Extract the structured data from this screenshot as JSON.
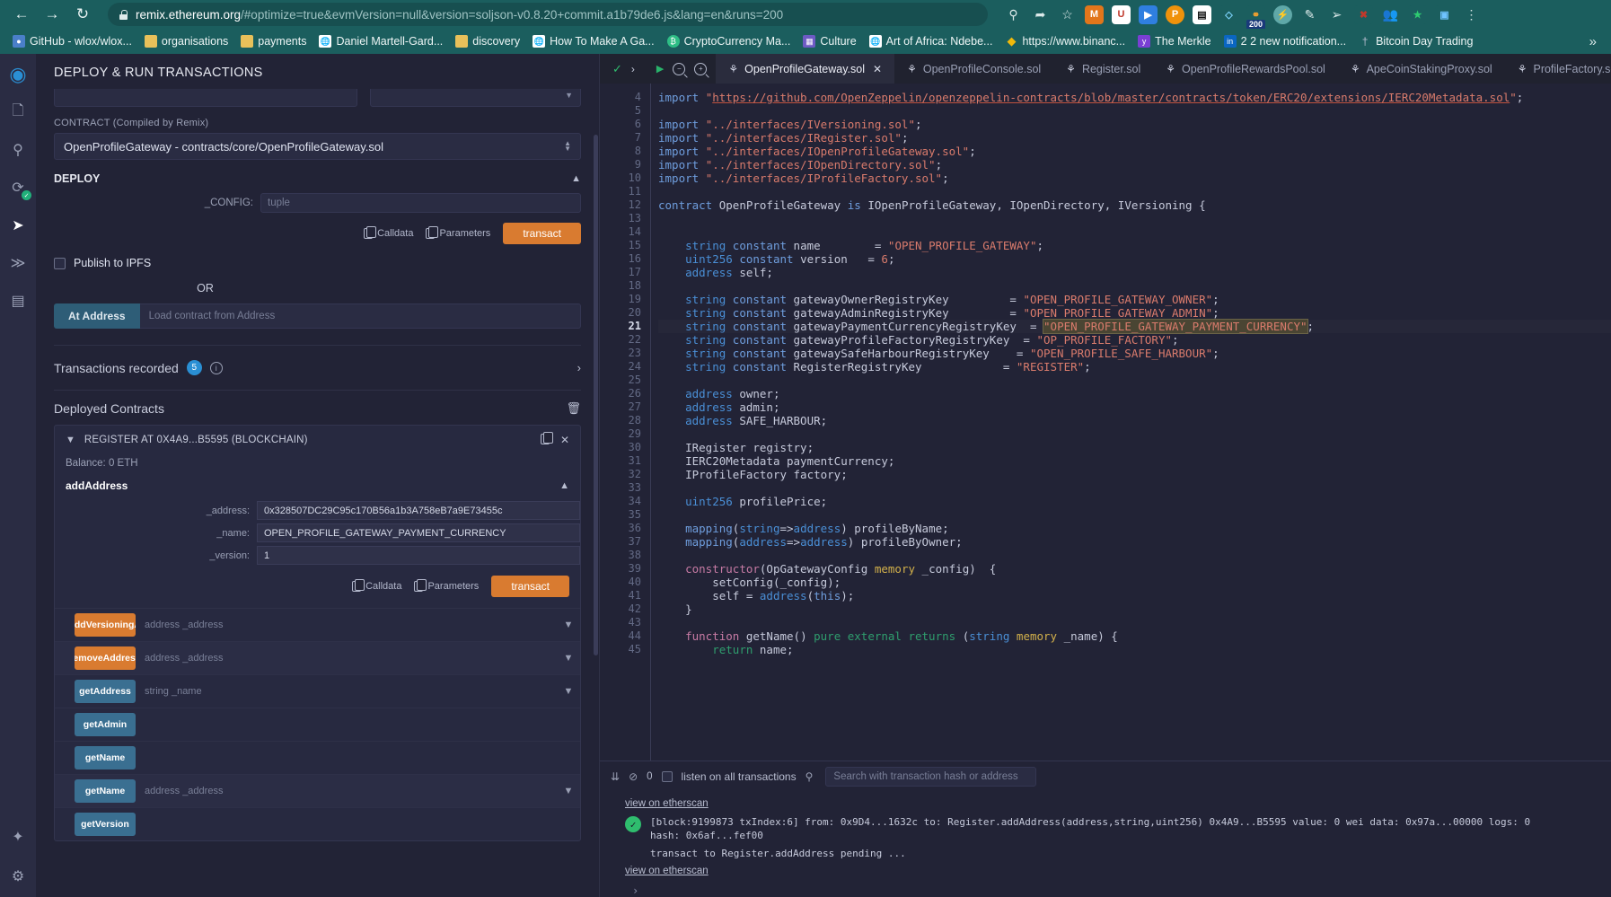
{
  "browser": {
    "url_prefix": "remix.ethereum.org",
    "url_suffix": "/#optimize=true&evmVersion=null&version=soljson-v0.8.20+commit.a1b79de6.js&lang=en&runs=200",
    "nav": {
      "back": "←",
      "forward": "→",
      "reload": "↻"
    },
    "toolbar_icons": [
      "search-icon",
      "share-icon",
      "bookmark-star-icon",
      "metamask-extension",
      "opera-wallet-extension",
      "kite-extension",
      "phantom-extension",
      "qr-extension",
      "brave-wallet-extension",
      "feed-extension",
      "flash-extension",
      "pen-extension",
      "puzzle-extension",
      "cast-extension",
      "profile-avatar",
      "menu-icon"
    ],
    "bookmarks": [
      {
        "label": "GitHub - wlox/wlox...",
        "color": "#4a7fc9"
      },
      {
        "label": "organisations",
        "color": "#e8c05a"
      },
      {
        "label": "payments",
        "color": "#e8c05a"
      },
      {
        "label": "Daniel Martell-Gard...",
        "color": "#ffffff"
      },
      {
        "label": "discovery",
        "color": "#e8c05a"
      },
      {
        "label": "How To Make A Ga...",
        "color": "#ffffff"
      },
      {
        "label": "CryptoCurrency Ma...",
        "color": "#2ebd85"
      },
      {
        "label": "Culture",
        "color": "#6d5ac4"
      },
      {
        "label": "Art of Africa: Ndebe...",
        "color": "#ffffff"
      },
      {
        "label": "https://www.binanc...",
        "color": "#f0b90b"
      },
      {
        "label": "The Merkle",
        "color": "#7a3fd4"
      },
      {
        "label": "2 2 new notification...",
        "color": "#0a66c2"
      },
      {
        "label": "Bitcoin Day Trading",
        "color": "#b9bed1"
      }
    ],
    "bookmarks_overflow": "»"
  },
  "rail": {
    "items": [
      {
        "name": "remix-home-icon"
      },
      {
        "name": "file-explorer-icon"
      },
      {
        "name": "search-icon"
      },
      {
        "name": "solidity-compiler-icon",
        "badge": "✓"
      },
      {
        "name": "deploy-run-icon",
        "active": true
      },
      {
        "name": "debugger-icon"
      },
      {
        "name": "plugin-manager-icon"
      }
    ],
    "bottom": [
      {
        "name": "plugin-settings-icon"
      },
      {
        "name": "settings-gear-icon"
      }
    ]
  },
  "udapp": {
    "title": "DEPLOY & RUN TRANSACTIONS",
    "account_value": "",
    "gas_value": "",
    "contract_label": "CONTRACT (Compiled by Remix)",
    "contract_value": "OpenProfileGateway - contracts/core/OpenProfileGateway.sol",
    "deploy_label": "DEPLOY",
    "deploy_param_label": "_CONFIG:",
    "deploy_param_placeholder": "tuple",
    "calldata_label": "Calldata",
    "parameters_label": "Parameters",
    "transact_label": "transact",
    "publish_ipfs_label": "Publish to IPFS",
    "or_label": "OR",
    "at_address_label": "At Address",
    "at_address_placeholder": "Load contract from Address",
    "transactions_recorded_label": "Transactions recorded",
    "transactions_recorded_count": "5",
    "deployed_contracts_label": "Deployed Contracts",
    "contract_card": {
      "title": "REGISTER AT 0X4A9...B5595 (BLOCKCHAIN)",
      "balance": "Balance: 0 ETH",
      "function_name": "addAddress",
      "params": [
        {
          "label": "_address:",
          "value": "0x328507DC29C95c170B56a1b3A758eB7a9E73455c"
        },
        {
          "label": "_name:",
          "value": "OPEN_PROFILE_GATEWAY_PAYMENT_CURRENCY"
        },
        {
          "label": "_version:",
          "value": "1"
        }
      ],
      "calldata_label": "Calldata",
      "parameters_label": "Parameters",
      "transact_label": "transact"
    },
    "functions": [
      {
        "name": "addVersioningA",
        "kind": "write",
        "placeholder": "address _address",
        "chevron": true,
        "alt": false
      },
      {
        "name": "removeAddress",
        "kind": "write",
        "placeholder": "address _address",
        "chevron": true,
        "alt": true
      },
      {
        "name": "getAddress",
        "kind": "read",
        "placeholder": "string _name",
        "chevron": true,
        "alt": false
      },
      {
        "name": "getAdmin",
        "kind": "read",
        "placeholder": "",
        "chevron": false,
        "alt": false
      },
      {
        "name": "getName",
        "kind": "read",
        "placeholder": "",
        "chevron": false,
        "alt": false
      },
      {
        "name": "getName",
        "kind": "read",
        "placeholder": "address _address",
        "chevron": true,
        "alt": true
      },
      {
        "name": "getVersion",
        "kind": "read",
        "placeholder": "",
        "chevron": false,
        "alt": false
      }
    ]
  },
  "editor": {
    "controls": {
      "check": "✓",
      "chevron": "›",
      "play": "▶",
      "zoom_out": "zoom-out-icon",
      "zoom_in": "zoom-in-icon"
    },
    "tabs": [
      {
        "label": "OpenProfileGateway.sol",
        "active": true,
        "closable": true
      },
      {
        "label": "OpenProfileConsole.sol",
        "active": false,
        "closable": false
      },
      {
        "label": "Register.sol",
        "active": false,
        "closable": false
      },
      {
        "label": "OpenProfileRewardsPool.sol",
        "active": false,
        "closable": false
      },
      {
        "label": "ApeCoinStakingProxy.sol",
        "active": false,
        "closable": false
      },
      {
        "label": "ProfileFactory.so",
        "active": false,
        "closable": false
      }
    ],
    "first_line": 4,
    "current_line": 21,
    "lines": [
      {
        "n": 4,
        "html": "<span class=\"k\">import</span> <span class=\"str\">\"</span><span class=\"link\">https://github.com/OpenZeppelin/openzeppelin-contracts/blob/master/contracts/token/ERC20/extensions/IERC20Metadata.sol</span><span class=\"str\">\"</span><span class=\"plain\">;</span>"
      },
      {
        "n": 5,
        "html": ""
      },
      {
        "n": 6,
        "html": "<span class=\"k\">import</span> <span class=\"str\">\"../interfaces/IVersioning.sol\"</span><span class=\"plain\">;</span>"
      },
      {
        "n": 7,
        "html": "<span class=\"k\">import</span> <span class=\"str\">\"../interfaces/IRegister.sol\"</span><span class=\"plain\">;</span>"
      },
      {
        "n": 8,
        "html": "<span class=\"k\">import</span> <span class=\"str\">\"../interfaces/IOpenProfileGateway.sol\"</span><span class=\"plain\">;</span>"
      },
      {
        "n": 9,
        "html": "<span class=\"k\">import</span> <span class=\"str\">\"../interfaces/IOpenDirectory.sol\"</span><span class=\"plain\">;</span>"
      },
      {
        "n": 10,
        "html": "<span class=\"k\">import</span> <span class=\"str\">\"../interfaces/IProfileFactory.sol\"</span><span class=\"plain\">;</span>"
      },
      {
        "n": 11,
        "html": ""
      },
      {
        "n": 12,
        "html": "<span class=\"k\">contract</span> <span class=\"plain\">OpenProfileGateway</span> <span class=\"k\">is</span> <span class=\"plain\">IOpenProfileGateway, IOpenDirectory, IVersioning {</span>"
      },
      {
        "n": 13,
        "html": ""
      },
      {
        "n": 14,
        "html": ""
      },
      {
        "n": 15,
        "html": "    <span class=\"typ\">string</span> <span class=\"k\">constant</span> <span class=\"plain\">name        =</span> <span class=\"str\">\"OPEN_PROFILE_GATEWAY\"</span><span class=\"plain\">;</span>"
      },
      {
        "n": 16,
        "html": "    <span class=\"typ\">uint256</span> <span class=\"k\">constant</span> <span class=\"plain\">version   =</span> <span class=\"num\">6</span><span class=\"plain\">;</span>"
      },
      {
        "n": 17,
        "html": "    <span class=\"typ\">address</span> <span class=\"plain\">self;</span>"
      },
      {
        "n": 18,
        "html": ""
      },
      {
        "n": 19,
        "html": "    <span class=\"typ\">string</span> <span class=\"k\">constant</span> <span class=\"plain\">gatewayOwnerRegistryKey         =</span> <span class=\"str\">\"OPEN_PROFILE_GATEWAY_OWNER\"</span><span class=\"plain\">;</span>"
      },
      {
        "n": 20,
        "html": "    <span class=\"typ\">string</span> <span class=\"k\">constant</span> <span class=\"plain\">gatewayAdminRegistryKey         =</span> <span class=\"str\">\"OPEN_PROFILE_GATEWAY_ADMIN\"</span><span class=\"plain\">;</span>"
      },
      {
        "n": 21,
        "html": "    <span class=\"typ\">string</span> <span class=\"k\">constant</span> <span class=\"plain\">gatewayPaymentCurrencyRegistryKey  =</span> <span class=\"str hl\">\"OPEN_PROFILE_GATEWAY_PAYMENT_CURRENCY\"</span><span class=\"plain\">;</span>"
      },
      {
        "n": 22,
        "html": "    <span class=\"typ\">string</span> <span class=\"k\">constant</span> <span class=\"plain\">gatewayProfileFactoryRegistryKey  =</span> <span class=\"str\">\"OP_PROFILE_FACTORY\"</span><span class=\"plain\">;</span>"
      },
      {
        "n": 23,
        "html": "    <span class=\"typ\">string</span> <span class=\"k\">constant</span> <span class=\"plain\">gatewaySafeHarbourRegistryKey    =</span> <span class=\"str\">\"OPEN_PROFILE_SAFE_HARBOUR\"</span><span class=\"plain\">;</span>"
      },
      {
        "n": 24,
        "html": "    <span class=\"typ\">string</span> <span class=\"k\">constant</span> <span class=\"plain\">RegisterRegistryKey            =</span> <span class=\"str\">\"REGISTER\"</span><span class=\"plain\">;</span>"
      },
      {
        "n": 25,
        "html": ""
      },
      {
        "n": 26,
        "html": "    <span class=\"typ\">address</span> <span class=\"plain\">owner;</span>"
      },
      {
        "n": 27,
        "html": "    <span class=\"typ\">address</span> <span class=\"plain\">admin;</span>"
      },
      {
        "n": 28,
        "html": "    <span class=\"typ\">address</span> <span class=\"plain\">SAFE_HARBOUR;</span>"
      },
      {
        "n": 29,
        "html": ""
      },
      {
        "n": 30,
        "html": "    <span class=\"plain\">IRegister registry;</span>"
      },
      {
        "n": 31,
        "html": "    <span class=\"plain\">IERC20Metadata paymentCurrency;</span>"
      },
      {
        "n": 32,
        "html": "    <span class=\"plain\">IProfileFactory factory;</span>"
      },
      {
        "n": 33,
        "html": ""
      },
      {
        "n": 34,
        "html": "    <span class=\"typ\">uint256</span> <span class=\"plain\">profilePrice;</span>"
      },
      {
        "n": 35,
        "html": ""
      },
      {
        "n": 36,
        "html": "    <span class=\"k\">mapping</span><span class=\"plain\">(</span><span class=\"typ\">string</span><span class=\"plain\">=&gt;</span><span class=\"typ\">address</span><span class=\"plain\">) profileByName;</span>"
      },
      {
        "n": 37,
        "html": "    <span class=\"k\">mapping</span><span class=\"plain\">(</span><span class=\"typ\">address</span><span class=\"plain\">=&gt;</span><span class=\"typ\">address</span><span class=\"plain\">) profileByOwner;</span>"
      },
      {
        "n": 38,
        "html": ""
      },
      {
        "n": 39,
        "html": "    <span class=\"pnk\">constructor</span><span class=\"plain\">(OpGatewayConfig</span> <span class=\"mem\">memory</span> <span class=\"plain\">_config)  {</span>"
      },
      {
        "n": 40,
        "html": "        <span class=\"plain\">setConfig(_config);</span>"
      },
      {
        "n": 41,
        "html": "        <span class=\"plain\">self =</span> <span class=\"typ\">address</span><span class=\"plain\">(</span><span class=\"k\">this</span><span class=\"plain\">);</span>"
      },
      {
        "n": 42,
        "html": "    <span class=\"plain\">}</span>"
      },
      {
        "n": 43,
        "html": ""
      },
      {
        "n": 44,
        "html": "    <span class=\"pnk\">function</span> <span class=\"plain\">getName()</span> <span class=\"grn\">pure external returns</span> <span class=\"plain\">(</span><span class=\"typ\">string</span> <span class=\"mem\">memory</span> <span class=\"plain\">_name) {</span>"
      },
      {
        "n": 45,
        "html": "        <span class=\"grn\">return</span> <span class=\"plain\">name;</span>"
      }
    ]
  },
  "terminal": {
    "icons": {
      "collapse": "collapse-icon",
      "clear": "no-entry-icon"
    },
    "pending_count": "0",
    "listen_label": "listen on all transactions",
    "search_placeholder": "Search with transaction hash or address",
    "entries": [
      {
        "type": "link",
        "text": "view on etherscan"
      },
      {
        "type": "log",
        "status": "✓",
        "line1": "[block:9199873 txIndex:6] from: 0x9D4...1632c to: Register.addAddress(address,string,uint256) 0x4A9...B5595 value: 0 wei data: 0x97a...00000 logs: 0",
        "line2": "hash: 0x6af...fef00"
      },
      {
        "type": "pending",
        "text": "transact to Register.addAddress pending ... "
      },
      {
        "type": "link",
        "text": "view on etherscan"
      }
    ],
    "prompt": "›"
  }
}
